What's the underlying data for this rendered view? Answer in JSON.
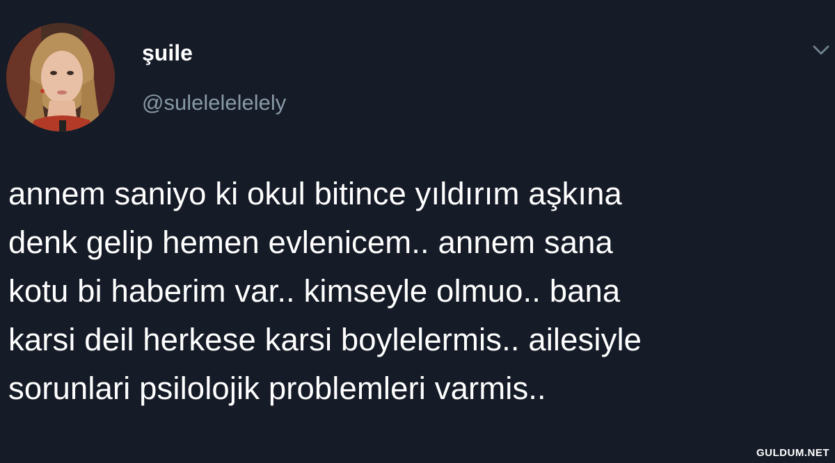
{
  "user": {
    "display_name": "şuile",
    "handle": "@sulelelelelely"
  },
  "tweet": {
    "lines": [
      "annem saniyo ki okul bitince yıldırım aşkına",
      "denk gelip hemen evlenicem.. annem sana",
      "kotu bi haberim var.. kimseyle olmuo.. bana",
      "karsi deil herkese karsi boylelermis.. ailesiyle",
      "sorunlari psilolojik problemleri varmis.."
    ]
  },
  "icons": {
    "avatar": "profile-photo",
    "caret": "chevron-down-icon"
  },
  "watermark": "GULDUM.NET",
  "colors": {
    "background": "#151b27",
    "text": "#ffffff",
    "handle": "#8899a6",
    "caret": "#6e7f8e"
  }
}
